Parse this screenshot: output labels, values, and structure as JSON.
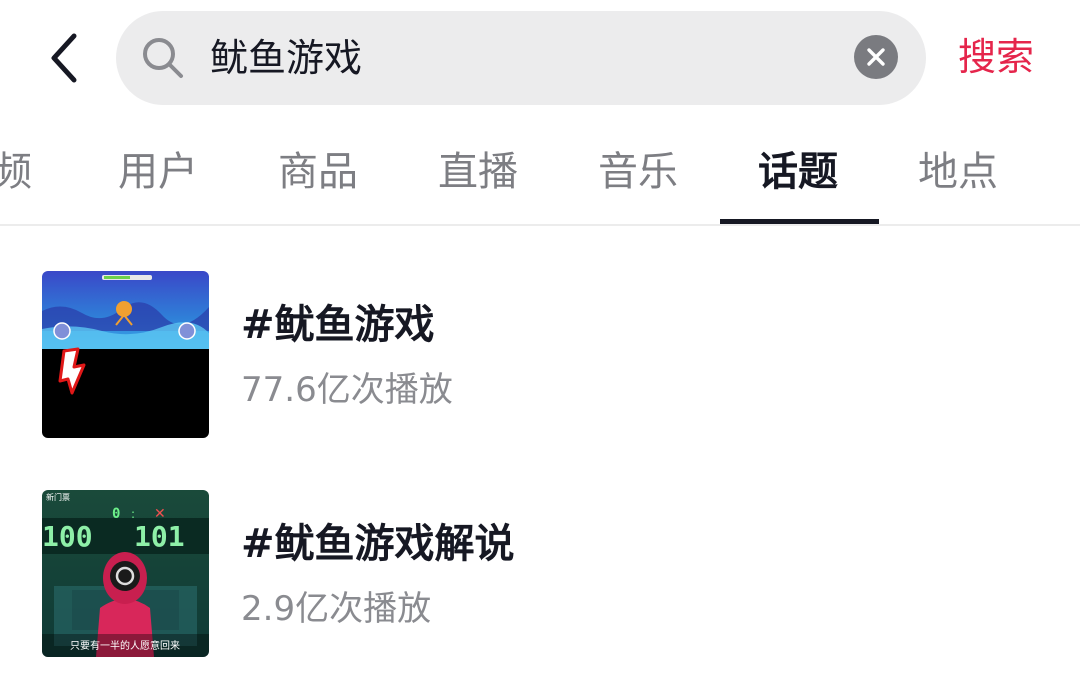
{
  "header": {
    "search_query": "鱿鱼游戏",
    "search_action_label": "搜索"
  },
  "tabs": [
    {
      "label": "频"
    },
    {
      "label": "用户"
    },
    {
      "label": "商品"
    },
    {
      "label": "直播"
    },
    {
      "label": "音乐"
    },
    {
      "label": "话题",
      "active": true
    },
    {
      "label": "地点"
    }
  ],
  "results": [
    {
      "title": "#鱿鱼游戏",
      "plays": "77.6亿次播放"
    },
    {
      "title": "#鱿鱼游戏解说",
      "plays": "2.9亿次播放",
      "thumb_caption": "只要有一半的人愿意回来",
      "thumb_score_left": "100",
      "thumb_score_right": "101",
      "thumb_logo_text": "新门票"
    }
  ],
  "colors": {
    "accent": "#e5254b",
    "text_primary": "#161823",
    "text_secondary": "#8a8b90",
    "search_bg": "#ececed"
  },
  "icons": {
    "back": "chevron-left-icon",
    "search": "search-icon",
    "clear": "close-circle-icon"
  }
}
